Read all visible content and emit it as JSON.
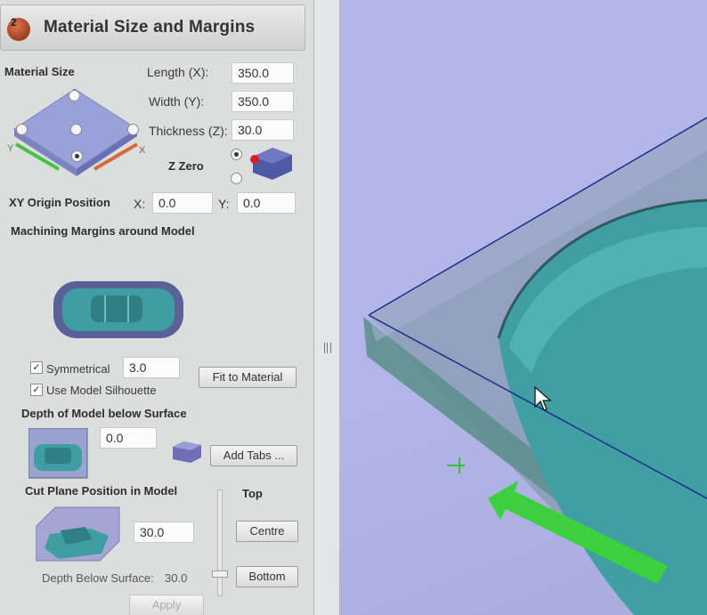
{
  "header": {
    "step_number": "2",
    "title": "Material Size and Margins"
  },
  "material_size": {
    "section_label": "Material Size",
    "length_label": "Length (X):",
    "length_value": "350.0",
    "width_label": "Width (Y):",
    "width_value": "350.0",
    "thickness_label": "Thickness (Z):",
    "thickness_value": "30.0",
    "z_zero_label": "Z Zero",
    "axis_y": "Y",
    "axis_x": "X"
  },
  "xy_origin": {
    "label": "XY Origin Position",
    "x_label": "X:",
    "x_value": "0.0",
    "y_label": "Y:",
    "y_value": "0.0"
  },
  "margins": {
    "section_label": "Machining Margins around Model",
    "symmetrical_label": "Symmetrical",
    "symmetrical_value": "3.0",
    "use_silhouette_label": "Use Model Silhouette",
    "fit_button": "Fit to Material"
  },
  "depth": {
    "section_label": "Depth of Model below Surface",
    "value": "0.0",
    "add_tabs_button": "Add Tabs ..."
  },
  "cut_plane": {
    "section_label": "Cut Plane Position in Model",
    "top_label": "Top",
    "value": "30.0",
    "centre_button": "Centre",
    "bottom_button": "Bottom",
    "depth_below_label": "Depth Below Surface:",
    "depth_below_value": "30.0"
  },
  "footer": {
    "apply_button": "Apply"
  },
  "colors": {
    "panel_bg": "#dcdedd",
    "viewport_bg": "#b4b7ea",
    "model_teal": "#3f9fa2",
    "origin_arrow": "#3ecf3e",
    "edge_line": "#1b2f8a"
  }
}
